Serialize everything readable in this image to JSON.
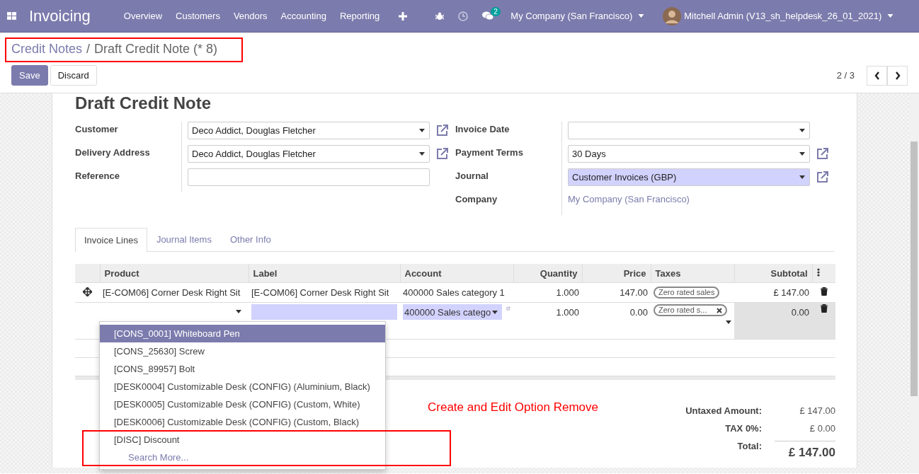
{
  "navbar": {
    "app_name": "Invoicing",
    "menu": [
      "Overview",
      "Customers",
      "Vendors",
      "Accounting",
      "Reporting"
    ],
    "messages_count": "2",
    "company": "My Company (San Francisco)",
    "user": "Mitchell Admin (V13_sh_helpdesk_26_01_2021)"
  },
  "breadcrumb": {
    "parent": "Credit Notes",
    "separator": "/",
    "current": "Draft Credit Note (* 8)"
  },
  "buttons": [
    {
      "label": "Save",
      "kind": "primary"
    },
    {
      "label": "Discard",
      "kind": "secondary"
    }
  ],
  "pager": "2 / 3",
  "form": {
    "title": "Draft Credit Note",
    "left_fields": [
      {
        "label": "Customer",
        "kind": "select",
        "value": "Deco Addict, Douglas Fletcher",
        "required": false,
        "external_link": true
      },
      {
        "label": "Delivery Address",
        "kind": "select",
        "value": "Deco Addict, Douglas Fletcher",
        "required": false,
        "external_link": true
      },
      {
        "label": "Reference",
        "kind": "input",
        "required": false,
        "external_link": false
      }
    ],
    "right_fields": [
      {
        "label": "Invoice Date",
        "kind": "select",
        "required": false,
        "external_link": false
      },
      {
        "label": "Payment Terms",
        "kind": "select",
        "value": "30 Days",
        "required": false,
        "external_link": true
      },
      {
        "label": "Journal",
        "kind": "select",
        "value": "Customer Invoices (GBP)",
        "required": true,
        "external_link": true
      },
      {
        "label": "Company",
        "kind": "link",
        "value": "My Company (San Francisco)",
        "external_link": false
      }
    ]
  },
  "tabs": [
    {
      "label": "Invoice Lines",
      "selected": true
    },
    {
      "label": "Journal Items",
      "selected": false
    },
    {
      "label": "Other Info",
      "selected": false
    }
  ],
  "table": {
    "columns": [
      "Product",
      "Label",
      "Account",
      "Quantity",
      "Price",
      "Taxes",
      "Subtotal"
    ],
    "rows": [
      {
        "kind": "display",
        "product": "[E-COM06] Corner Desk Right Sit",
        "label": "[E-COM06] Corner Desk Right Sit",
        "account": "400000 Sales category 1",
        "quantity": "1.000",
        "price": "147.00",
        "tax": "Zero rated sales",
        "subtotal": "£ 147.00"
      },
      {
        "kind": "edit",
        "account": "400000 Sales catego",
        "quantity": "1.000",
        "price": "0.00",
        "tax": "Zero rated s...",
        "subtotal": "0.00"
      }
    ]
  },
  "product_dropdown": {
    "items": [
      {
        "label": "[CONS_0001] Whiteboard Pen",
        "selected": true
      },
      {
        "label": "[CONS_25630] Screw",
        "selected": false
      },
      {
        "label": "[CONS_89957] Bolt",
        "selected": false
      },
      {
        "label": "[DESK0004] Customizable Desk (CONFIG) (Aluminium, Black)",
        "selected": false
      },
      {
        "label": "[DESK0005] Customizable Desk (CONFIG) (Custom, White)",
        "selected": false
      },
      {
        "label": "[DESK0006] Customizable Desk (CONFIG) (Custom, Black)",
        "selected": false
      },
      {
        "label": "[DISC] Discount",
        "selected": false
      }
    ],
    "search_more": "Search More..."
  },
  "totals": [
    {
      "kind": "line",
      "label": "Untaxed Amount:",
      "value": "£ 147.00"
    },
    {
      "kind": "line",
      "label": "TAX 0%:",
      "value": "£ 0.00"
    },
    {
      "kind": "total",
      "label": "Total:",
      "value": "£ 147.00"
    }
  ],
  "annotation": {
    "text": "Create and Edit Option Remove"
  }
}
